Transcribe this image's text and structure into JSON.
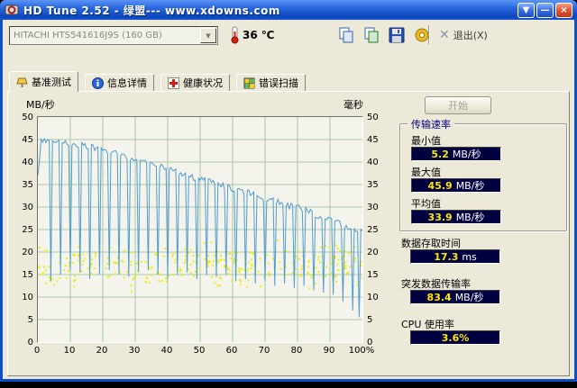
{
  "window": {
    "title": "HD Tune 2.52 - 绿盟--- www.xdowns.com"
  },
  "toolbar": {
    "drive_select": "HITACHI HTS541616J9S (160 GB)",
    "temperature": "36 ℃",
    "exit_label": "退出(X)"
  },
  "tabs": [
    {
      "label": "基准测试"
    },
    {
      "label": "信息详情"
    },
    {
      "label": "健康状况"
    },
    {
      "label": "错误扫描"
    }
  ],
  "panel": {
    "start_label": "开始"
  },
  "results": {
    "transfer_group_title": "传输速率",
    "min_label": "最小值",
    "min_value": "5.2",
    "min_unit": "MB/秒",
    "max_label": "最大值",
    "max_value": "45.9",
    "max_unit": "MB/秒",
    "avg_label": "平均值",
    "avg_value": "33.9",
    "avg_unit": "MB/秒",
    "access_label": "数据存取时间",
    "access_value": "17.3",
    "access_unit": "ms",
    "burst_label": "突发数据传输率",
    "burst_value": "83.4",
    "burst_unit": "MB/秒",
    "cpu_label": "CPU 使用率",
    "cpu_value": "3.6%",
    "cpu_unit": ""
  },
  "chart_data": {
    "type": "line+scatter",
    "left_axis": {
      "label": "MB/秒",
      "min": 0,
      "max": 50,
      "step": 5
    },
    "right_axis": {
      "label": "毫秒",
      "min": 0,
      "max": 50,
      "step": 5
    },
    "x_axis": {
      "min": 0,
      "max": 100,
      "step": 10,
      "unit": "%"
    },
    "grid": true,
    "series": [
      {
        "name": "传输速率",
        "type": "line",
        "unit": "MB/秒",
        "color": "#4f9bd0",
        "jitter": 0.7,
        "seed": 5,
        "trend": [
          [
            0,
            37
          ],
          [
            1,
            44.5
          ],
          [
            3,
            45
          ],
          [
            8,
            44.5
          ],
          [
            12,
            44
          ],
          [
            16,
            43.5
          ],
          [
            20,
            42.5
          ],
          [
            24,
            42
          ],
          [
            28,
            41
          ],
          [
            32,
            40
          ],
          [
            36,
            39.5
          ],
          [
            40,
            38.5
          ],
          [
            44,
            37.5
          ],
          [
            48,
            36.5
          ],
          [
            52,
            36
          ],
          [
            56,
            35
          ],
          [
            60,
            34
          ],
          [
            64,
            33.5
          ],
          [
            68,
            32.5
          ],
          [
            72,
            31.5
          ],
          [
            76,
            30.5
          ],
          [
            80,
            30
          ],
          [
            84,
            29
          ],
          [
            88,
            27.5
          ],
          [
            92,
            26.5
          ],
          [
            96,
            25.5
          ],
          [
            100,
            24.5
          ]
        ],
        "spikes": [
          [
            4,
            13.5
          ],
          [
            7,
            15
          ],
          [
            10,
            16
          ],
          [
            13,
            15.5
          ],
          [
            16,
            14
          ],
          [
            19,
            15
          ],
          [
            22,
            16
          ],
          [
            25,
            15
          ],
          [
            28,
            14.5
          ],
          [
            31,
            15.5
          ],
          [
            34,
            16
          ],
          [
            37,
            15
          ],
          [
            40,
            14
          ],
          [
            43,
            15
          ],
          [
            46,
            15.5
          ],
          [
            49,
            14
          ],
          [
            52,
            15
          ],
          [
            55,
            14.5
          ],
          [
            58,
            15
          ],
          [
            61,
            13.5
          ],
          [
            64,
            14
          ],
          [
            67,
            13
          ],
          [
            70,
            13.5
          ],
          [
            73,
            12.5
          ],
          [
            76,
            13
          ],
          [
            79,
            12
          ],
          [
            82,
            12.5
          ],
          [
            85,
            11.5
          ],
          [
            88,
            11
          ],
          [
            91,
            10.5
          ],
          [
            94,
            9
          ],
          [
            97,
            7
          ],
          [
            99,
            5.5
          ]
        ]
      },
      {
        "name": "存取时间",
        "type": "scatter",
        "unit": "ms",
        "color": "#ecec10",
        "count": 320,
        "y_mean": 17,
        "y_spread": 4.5,
        "y_min": 6,
        "y_max": 33,
        "seed": 97
      }
    ]
  }
}
